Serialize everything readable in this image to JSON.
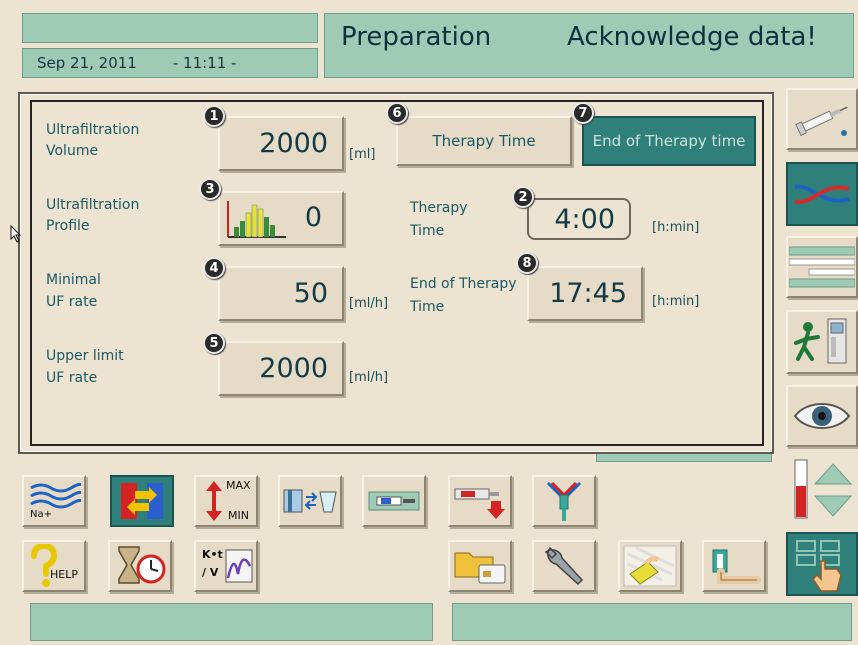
{
  "header": {
    "date": "Sep 21, 2011",
    "time": "- 11:11 -",
    "mode": "Preparation",
    "message": "Acknowledge data!"
  },
  "params": {
    "uf_volume": {
      "label1": "Ultrafiltration",
      "label2": "Volume",
      "value": "2000",
      "unit": "[ml]",
      "badge": "1"
    },
    "uf_profile": {
      "label1": "Ultrafiltration",
      "label2": "Profile",
      "value": "0",
      "badge": "3"
    },
    "min_uf_rate": {
      "label1": "Minimal",
      "label2": "UF rate",
      "value": "50",
      "unit": "[ml/h]",
      "badge": "4"
    },
    "upper_uf_rate": {
      "label1": "Upper limit",
      "label2": "UF rate",
      "value": "2000",
      "unit": "[ml/h]",
      "badge": "5"
    },
    "therapy_time_tab": {
      "label": "Therapy Time",
      "badge": "6"
    },
    "end_therapy_tab": {
      "label": "End of Therapy time",
      "badge": "7"
    },
    "therapy_time": {
      "label1": "Therapy",
      "label2": "Time",
      "value": "4:00",
      "unit": "[h:min]",
      "badge": "2"
    },
    "end_therapy": {
      "label1": "End of Therapy",
      "label2": "Time",
      "value": "17:45",
      "unit": "[h:min]",
      "badge": "8"
    }
  },
  "toolbar": {
    "na_label": "Na+",
    "max_label": "MAX",
    "min_label": "MIN",
    "help_label": "HELP",
    "ktv_label": "K•t / V"
  },
  "colors": {
    "background": "#ece3d0",
    "panel_green": "#9ecab6",
    "selected_tab": "#2f7f7b",
    "text": "#1b5868"
  }
}
